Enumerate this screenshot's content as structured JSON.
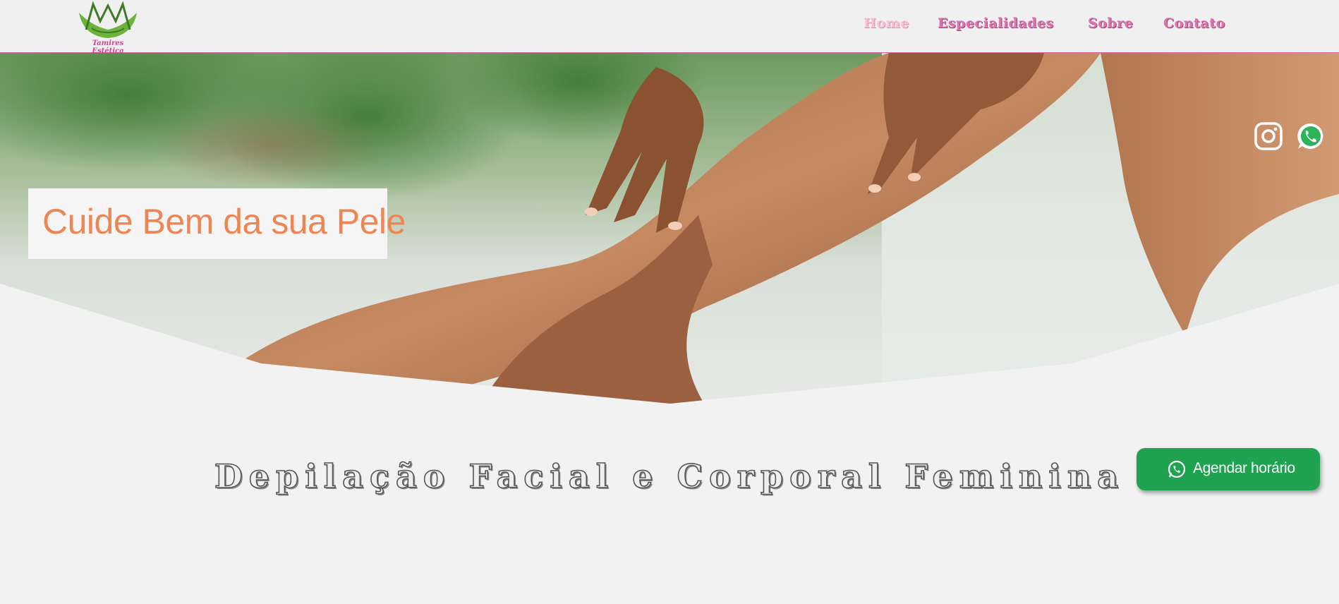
{
  "header": {
    "logo_text": "Tamires Estética",
    "nav": [
      {
        "label": "Home",
        "active": true
      },
      {
        "label": "Especialidades",
        "active": false
      },
      {
        "label": "Sobre",
        "active": false
      },
      {
        "label": "Contato",
        "active": false
      }
    ]
  },
  "hero": {
    "headline": "Cuide Bem da sua Pele",
    "social": [
      "instagram-icon",
      "whatsapp-icon"
    ]
  },
  "section": {
    "title": "Depilação Facial e Corporal Feminina"
  },
  "cta": {
    "label": "Agendar horário",
    "icon": "whatsapp-icon"
  },
  "colors": {
    "accent_pink": "#d876b0",
    "headline_orange": "#ee8654",
    "cta_green": "#1fa351",
    "background": "#f2f2f2"
  }
}
